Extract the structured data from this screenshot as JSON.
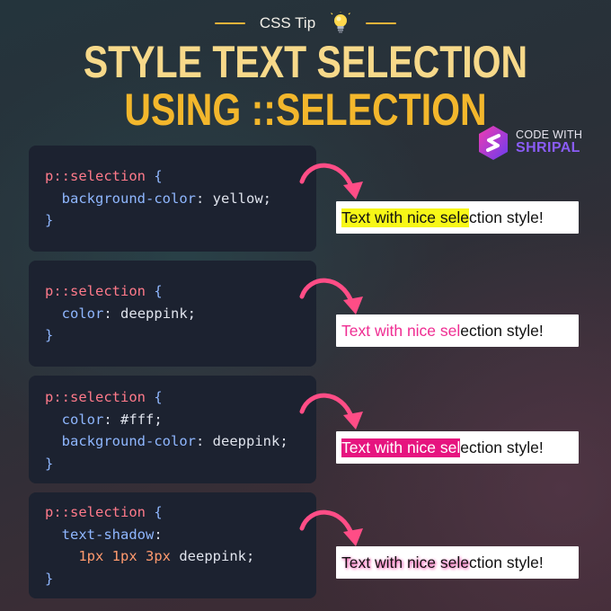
{
  "header": {
    "tip_label": "CSS Tip",
    "bulb_icon": "lightbulb-icon",
    "title_line1": "STYLE TEXT SELECTION",
    "title_line2": "USING ::SELECTION"
  },
  "brand": {
    "logo_icon": "code-with-shripal-logo",
    "line1": "CODE WITH",
    "line2": "SHRIPAL"
  },
  "examples": [
    {
      "selector": "p::selection",
      "open_brace": "{",
      "close_brace": "}",
      "prop1": "background-color",
      "val1": "yellow;",
      "demo_selected": "Text with nice sele",
      "demo_rest": "ction style!"
    },
    {
      "selector": "p::selection",
      "open_brace": "{",
      "close_brace": "}",
      "prop1": "color",
      "val1": "deeppink;",
      "demo_selected": "Text with nice sel",
      "demo_rest": "ection style!"
    },
    {
      "selector": "p::selection",
      "open_brace": "{",
      "close_brace": "}",
      "prop1": "color",
      "val1": "#fff;",
      "prop2": "background-color",
      "val2": "deeppink;",
      "demo_selected": "Text with nice sel",
      "demo_rest": "ection style!"
    },
    {
      "selector": "p::selection",
      "open_brace": "{",
      "close_brace": "}",
      "prop1": "text-shadow",
      "val1_nums": "1px 1px 3px",
      "val1_word": "deeppink;",
      "demo_selected": "Text with nice sele",
      "demo_rest": "ction style!"
    }
  ],
  "colors": {
    "title_light": "#f7d98a",
    "title_gold": "#f3b72c",
    "arrow": "#ff4d86",
    "deeppink": "#ff1493",
    "yellow": "#f7f717",
    "card_bg": "#1c2230"
  }
}
